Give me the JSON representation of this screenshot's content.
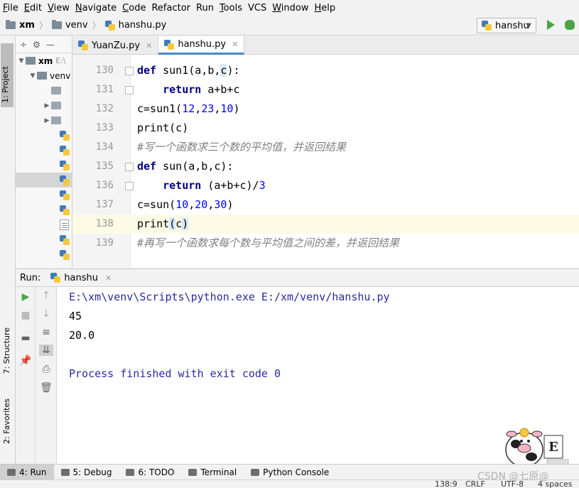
{
  "menu": [
    {
      "u": "F",
      "rest": "ile"
    },
    {
      "u": "E",
      "rest": "dit"
    },
    {
      "u": "V",
      "rest": "iew"
    },
    {
      "u": "N",
      "rest": "avigate"
    },
    {
      "u": "C",
      "rest": "ode"
    },
    {
      "u": "",
      "rest": "Refactor"
    },
    {
      "u": "",
      "rest": "Run"
    },
    {
      "u": "T",
      "rest": "ools"
    },
    {
      "u": "",
      "rest": "VCS"
    },
    {
      "u": "W",
      "rest": "indow"
    },
    {
      "u": "H",
      "rest": "elp"
    }
  ],
  "breadcrumb": {
    "project": "xm",
    "folder": "venv",
    "file": "hanshu.py"
  },
  "run_config": {
    "name": "hanshu"
  },
  "left_strip": {
    "project_tab": "1: Project",
    "structure_tab": "7: Structure",
    "favorites_tab": "2: Favorites"
  },
  "project_panel": {
    "root": "xm",
    "root_path": "E:\\",
    "venv": "venv"
  },
  "editor_tabs": [
    {
      "label": "YuanZu.py",
      "active": false
    },
    {
      "label": "hanshu.py",
      "active": true
    }
  ],
  "code": {
    "l130": {
      "num": "130",
      "kw": "def",
      "text": " sun1(a,b,",
      "hl": "c",
      "tail": "):"
    },
    "l131": {
      "num": "131",
      "kw": "return",
      "text": " a+b+c"
    },
    "l132": {
      "num": "132",
      "pre": "c=sun1(",
      "n1": "12",
      "c1": ",",
      "n2": "23",
      "c2": ",",
      "n3": "10",
      "post": ")"
    },
    "l133": {
      "num": "133",
      "text": "print(c)"
    },
    "l134": {
      "num": "134",
      "comment": "#写一个函数求三个数的平均值，并返回结果"
    },
    "l135": {
      "num": "135",
      "kw": "def",
      "text": " sun(a,b,c):"
    },
    "l136": {
      "num": "136",
      "kw": "return",
      "pre": " (a+b+c)/",
      "n1": "3"
    },
    "l137": {
      "num": "137",
      "pre": "c=sun(",
      "n1": "10",
      "c1": ",",
      "n2": "20",
      "c2": ",",
      "n3": "30",
      "post": ")"
    },
    "l138": {
      "num": "138",
      "pre": "print",
      "hl1": "(",
      "mid": "c",
      "hl2": ")"
    },
    "l139": {
      "num": "139",
      "comment": "#再写一个函数求每个数与平均值之间的差，并返回结果"
    }
  },
  "run_panel": {
    "label": "Run:",
    "tab": "hanshu"
  },
  "console": {
    "path": "E:\\xm\\venv\\Scripts\\python.exe E:/xm/venv/hanshu.py",
    "out1": "45",
    "out2": "20.0",
    "exit": "Process finished with exit code 0"
  },
  "bottom_tabs": [
    {
      "label": "4: Run",
      "active": true
    },
    {
      "label": "5: Debug",
      "active": false
    },
    {
      "label": "6: TODO",
      "active": false
    },
    {
      "label": "Terminal",
      "active": false
    },
    {
      "label": "Python Console",
      "active": false
    }
  ],
  "status": {
    "position": "138:9",
    "line_sep": "CRLF",
    "encoding": "UTF-8",
    "indent": "4 spaces"
  },
  "watermark": "CSDN @七原@",
  "colors": {
    "keyword": "#000080",
    "number": "#0000ff",
    "comment": "#808080",
    "accent": "#4a88c7",
    "run_green": "#4aa547"
  }
}
